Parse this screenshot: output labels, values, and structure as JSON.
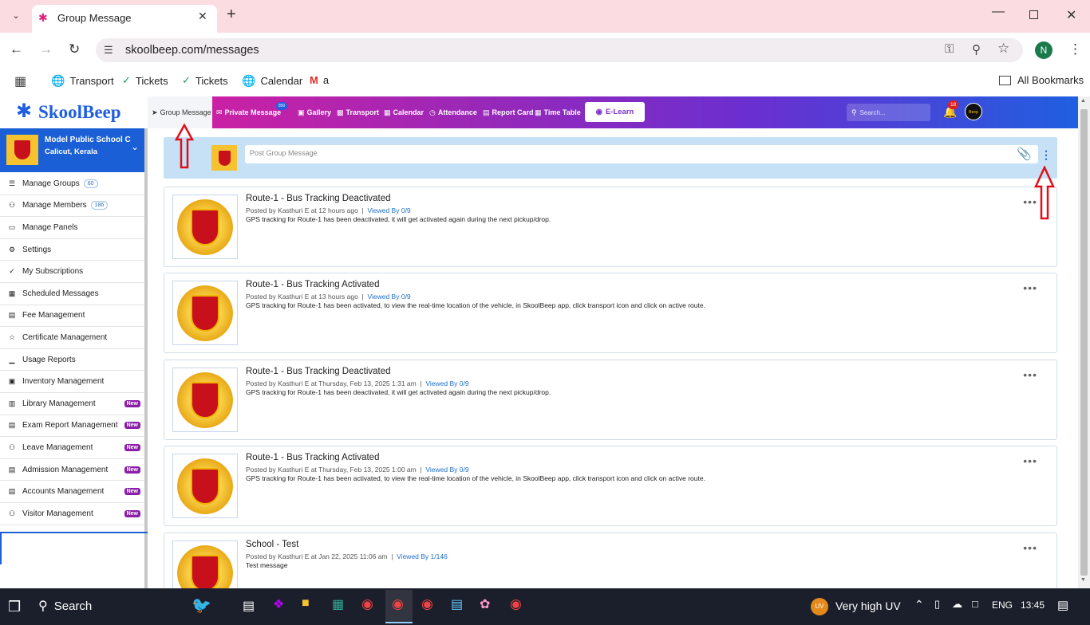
{
  "browser": {
    "tab_title": "Group Message",
    "url": "skoolbeep.com/messages",
    "profile_initial": "N",
    "bookmarks": [
      {
        "label": "Transport",
        "icon": "globe-icon"
      },
      {
        "label": "Tickets",
        "icon": "ticket-icon"
      },
      {
        "label": "Tickets",
        "icon": "ticket-icon"
      },
      {
        "label": "Calendar",
        "icon": "globe-icon"
      },
      {
        "label": "a",
        "icon": "gmail-icon"
      }
    ],
    "all_bookmarks": "All Bookmarks"
  },
  "app": {
    "logo": "SkoolBeep",
    "nav": [
      {
        "label": "Group Message",
        "icon": "send-icon"
      },
      {
        "label": "Private Message",
        "icon": "mail-icon"
      },
      {
        "label": "Gallery",
        "icon": "image-icon"
      },
      {
        "label": "Transport",
        "icon": "bus-icon"
      },
      {
        "label": "Calendar",
        "icon": "calendar-icon"
      },
      {
        "label": "Attendance",
        "icon": "clock-icon"
      },
      {
        "label": "Report Card",
        "icon": "doc-icon"
      },
      {
        "label": "Time Table",
        "icon": "table-icon"
      }
    ],
    "private_badge": "850",
    "elearn": "E-Learn",
    "search_placeholder": "Search...",
    "notif_count": "18",
    "avatar_text": "Beep"
  },
  "school": {
    "name": "Model Public School C",
    "location": "Calicut, Kerala"
  },
  "sidebar": [
    {
      "label": "Manage Groups",
      "badge": "60",
      "icon": "list-icon"
    },
    {
      "label": "Manage Members",
      "badge": "186",
      "icon": "users-icon"
    },
    {
      "label": "Manage Panels",
      "icon": "monitor-icon"
    },
    {
      "label": "Settings",
      "icon": "gear-icon"
    },
    {
      "label": "My Subscriptions",
      "icon": "check-icon"
    },
    {
      "label": "Scheduled Messages",
      "icon": "calendar-icon"
    },
    {
      "label": "Fee Management",
      "icon": "doc-icon"
    },
    {
      "label": "Certificate Management",
      "icon": "award-icon"
    },
    {
      "label": "Usage Reports",
      "icon": "chart-icon"
    },
    {
      "label": "Inventory Management",
      "icon": "box-icon"
    },
    {
      "label": "Library Management",
      "new": "New",
      "icon": "book-icon"
    },
    {
      "label": "Exam Report Management",
      "new": "New",
      "icon": "doc-icon"
    },
    {
      "label": "Leave Management",
      "new": "New",
      "icon": "person-icon"
    },
    {
      "label": "Admission Management",
      "new": "New",
      "icon": "card-icon"
    },
    {
      "label": "Accounts Management",
      "new": "New",
      "icon": "doc-icon"
    },
    {
      "label": "Visitor Management",
      "new": "New",
      "icon": "users-icon"
    }
  ],
  "post_placeholder": "Post Group Message",
  "posts": [
    {
      "title": "Route-1 - Bus Tracking Deactivated",
      "meta": "Posted by Kasthuri E at 12 hours ago",
      "viewed": "Viewed By 0/9",
      "body": "GPS tracking for Route-1 has been deactivated, it will get activated again during the next pickup/drop."
    },
    {
      "title": "Route-1 - Bus Tracking Activated",
      "meta": "Posted by Kasthuri E at 13 hours ago",
      "viewed": "Viewed By 0/9",
      "body": "GPS tracking for Route-1 has been activated, to view the real-time location of the vehicle, in SkoolBeep app, click transport icon and click on active route."
    },
    {
      "title": "Route-1 - Bus Tracking Deactivated",
      "meta": "Posted by Kasthuri E at Thursday, Feb 13, 2025 1:31 am",
      "viewed": "Viewed By 0/9",
      "body": "GPS tracking for Route-1 has been deactivated, it will get activated again during the next pickup/drop."
    },
    {
      "title": "Route-1 - Bus Tracking Activated",
      "meta": "Posted by Kasthuri E at Thursday, Feb 13, 2025 1:00 am",
      "viewed": "Viewed By 0/9",
      "body": "GPS tracking for Route-1 has been activated, to view the real-time location of the vehicle, in SkoolBeep app, click transport icon and click on active route."
    },
    {
      "title": "School - Test",
      "meta": "Posted by Kasthuri E at Jan 22, 2025 11:06 am",
      "viewed": "Viewed By 1/146",
      "body": "Test message"
    }
  ],
  "taskbar": {
    "search": "Search",
    "weather": "Very high UV",
    "uv": "UV",
    "lang": "ENG",
    "time": "13:45"
  }
}
